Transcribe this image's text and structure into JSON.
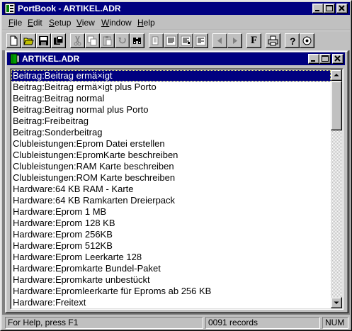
{
  "window": {
    "title": "PortBook - ARTIKEL.ADR"
  },
  "menu": [
    {
      "label": "File",
      "u": "F",
      "rest": "ile"
    },
    {
      "label": "Edit",
      "u": "E",
      "rest": "dit"
    },
    {
      "label": "Setup",
      "u": "S",
      "rest": "etup"
    },
    {
      "label": "View",
      "u": "V",
      "rest": "iew"
    },
    {
      "label": "Window",
      "u": "W",
      "rest": "indow"
    },
    {
      "label": "Help",
      "u": "H",
      "rest": "elp"
    }
  ],
  "toolbar": {
    "font_button_label": "F"
  },
  "child_window": {
    "title": "ARTIKEL.ADR"
  },
  "list": {
    "selected_index": 0,
    "items": [
      "Beitrag:Beitrag ermä×igt",
      "Beitrag:Beitrag ermä×igt plus Porto",
      "Beitrag:Beitrag normal",
      "Beitrag:Beitrag normal plus Porto",
      "Beitrag:Freibeitrag",
      "Beitrag:Sonderbeitrag",
      "Clubleistungen:Eprom Datei erstellen",
      "Clubleistungen:EpromKarte beschreiben",
      "Clubleistungen:RAM Karte beschreiben",
      "Clubleistungen:ROM Karte beschreiben",
      "Hardware:64 KB RAM - Karte",
      "Hardware:64 KB Ramkarten Dreierpack",
      "Hardware:Eprom 1 MB",
      "Hardware:Eprom 128 KB",
      "Hardware:Eprom 256KB",
      "Hardware:Eprom 512KB",
      "Hardware:Eprom Leerkarte 128",
      "Hardware:Epromkarte Bundel-Paket",
      "Hardware:Epromkarte unbestückt",
      "Hardware:Epromleerkarte für Eproms ab 256 KB",
      "Hardware:Freitext"
    ]
  },
  "statusbar": {
    "help": "For Help, press F1",
    "records": "0091 records",
    "num": "NUM"
  },
  "colors": {
    "titlebar": "#000080",
    "face": "#c0c0c0",
    "selection": "#000080"
  }
}
